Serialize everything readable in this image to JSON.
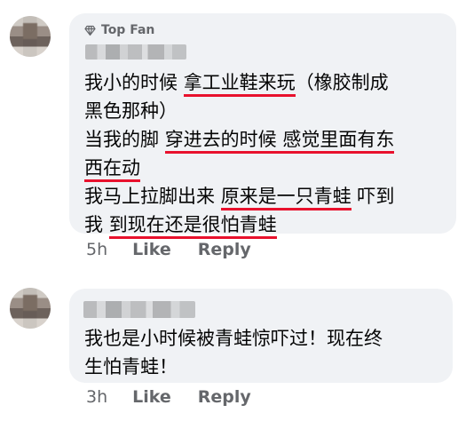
{
  "comments": [
    {
      "badge": "Top Fan",
      "lines": [
        [
          {
            "t": "我小的时候 ",
            "u": false
          },
          {
            "t": "拿工业鞋来玩",
            "u": true
          },
          {
            "t": "（橡胶制成",
            "u": false
          }
        ],
        [
          {
            "t": "黑色那种）",
            "u": false
          }
        ],
        [
          {
            "t": "当我的脚 ",
            "u": false
          },
          {
            "t": "穿进去的时候 感觉里面有东",
            "u": true
          }
        ],
        [
          {
            "t": "西在动",
            "u": true
          }
        ],
        [
          {
            "t": "我马上拉脚出来 ",
            "u": false
          },
          {
            "t": "原来是一只青蛙",
            "u": true
          },
          {
            "t": " 吓到",
            "u": false
          }
        ],
        [
          {
            "t": "我 ",
            "u": false
          },
          {
            "t": "到现在还是很怕青蛙",
            "u": true
          }
        ]
      ],
      "time": "5h",
      "like_label": "Like",
      "reply_label": "Reply"
    },
    {
      "lines": [
        [
          {
            "t": "我也是小时候被青蛙惊吓过！现在终",
            "u": false
          }
        ],
        [
          {
            "t": "生怕青蛙！",
            "u": false
          }
        ]
      ],
      "time": "3h",
      "like_label": "Like",
      "reply_label": "Reply"
    }
  ],
  "colors": {
    "bubble": "#f0f2f5",
    "meta": "#65676b",
    "underline": "#e8112d"
  },
  "icons": {
    "badge": "diamond-icon"
  }
}
